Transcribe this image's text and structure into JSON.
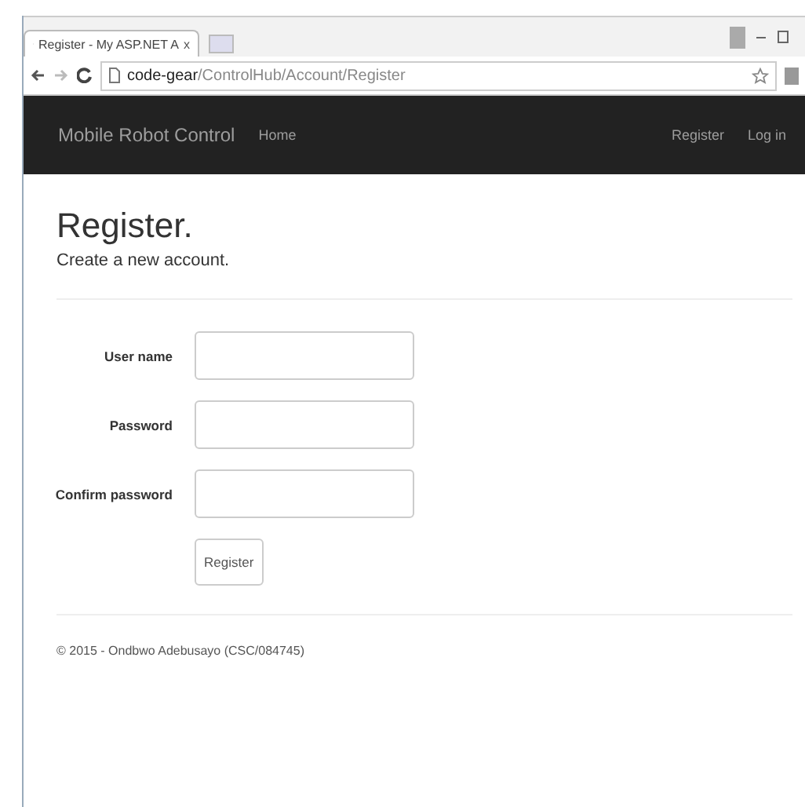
{
  "browser": {
    "tab_title": "Register - My ASP.NET A",
    "tab_close": "x",
    "url_host": "code-gear",
    "url_path": "/ControlHub/Account/Register"
  },
  "navbar": {
    "brand": "Mobile Robot Control",
    "links": [
      "Home"
    ],
    "right_links": [
      "Register",
      "Log in"
    ]
  },
  "page": {
    "title": "Register.",
    "subtitle": "Create a new account.",
    "fields": [
      {
        "label": "User name"
      },
      {
        "label": "Password"
      },
      {
        "label": "Confirm password"
      }
    ],
    "submit": "Register"
  },
  "footer": "© 2015 - Ondbwo Adebusayo (CSC/084745)"
}
